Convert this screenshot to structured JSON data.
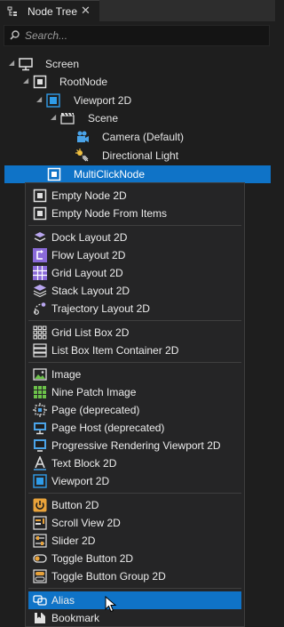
{
  "tab": {
    "title": "Node Tree",
    "close": "✕"
  },
  "search": {
    "placeholder": "Search..."
  },
  "tree": [
    {
      "label": "Screen",
      "icon": "screen-icon"
    },
    {
      "label": "RootNode",
      "icon": "node2d-icon"
    },
    {
      "label": "Viewport 2D",
      "icon": "viewport-icon"
    },
    {
      "label": "Scene",
      "icon": "scene-icon"
    },
    {
      "label": "Camera (Default)",
      "icon": "camera-icon"
    },
    {
      "label": "Directional Light",
      "icon": "light-icon"
    },
    {
      "label": "MultiClickNode",
      "icon": "node2d-icon",
      "selected": true
    }
  ],
  "menu": {
    "groups": [
      [
        {
          "label": "Empty Node 2D",
          "icon": "empty-node-icon"
        },
        {
          "label": "Empty Node From Items",
          "icon": "empty-node-icon"
        }
      ],
      [
        {
          "label": "Dock Layout 2D",
          "icon": "dock-layout-icon"
        },
        {
          "label": "Flow Layout 2D",
          "icon": "flow-layout-icon"
        },
        {
          "label": "Grid Layout 2D",
          "icon": "grid-layout-icon"
        },
        {
          "label": "Stack Layout 2D",
          "icon": "stack-layout-icon"
        },
        {
          "label": "Trajectory Layout 2D",
          "icon": "trajectory-layout-icon"
        }
      ],
      [
        {
          "label": "Grid List Box 2D",
          "icon": "grid-list-box-icon"
        },
        {
          "label": "List Box Item Container 2D",
          "icon": "list-box-icon"
        }
      ],
      [
        {
          "label": "Image",
          "icon": "image-icon"
        },
        {
          "label": "Nine Patch Image",
          "icon": "nine-patch-icon"
        },
        {
          "label": "Page (deprecated)",
          "icon": "page-icon"
        },
        {
          "label": "Page Host (deprecated)",
          "icon": "page-host-icon"
        },
        {
          "label": "Progressive Rendering Viewport 2D",
          "icon": "progressive-viewport-icon"
        },
        {
          "label": "Text Block 2D",
          "icon": "text-block-icon"
        },
        {
          "label": "Viewport 2D",
          "icon": "viewport-icon"
        }
      ],
      [
        {
          "label": "Button 2D",
          "icon": "button-icon"
        },
        {
          "label": "Scroll View 2D",
          "icon": "scroll-view-icon"
        },
        {
          "label": "Slider 2D",
          "icon": "slider-icon"
        },
        {
          "label": "Toggle Button 2D",
          "icon": "toggle-button-icon"
        },
        {
          "label": "Toggle Button Group 2D",
          "icon": "toggle-group-icon"
        }
      ],
      [
        {
          "label": "Alias",
          "icon": "alias-icon",
          "highlighted": true
        },
        {
          "label": "Bookmark",
          "icon": "bookmark-icon"
        }
      ]
    ]
  },
  "colors": {
    "selection": "#0f73c7",
    "background": "#1e1e1e",
    "menu": "#252526",
    "accent_orange": "#e8a23a",
    "accent_purple": "#9a7fe0"
  }
}
